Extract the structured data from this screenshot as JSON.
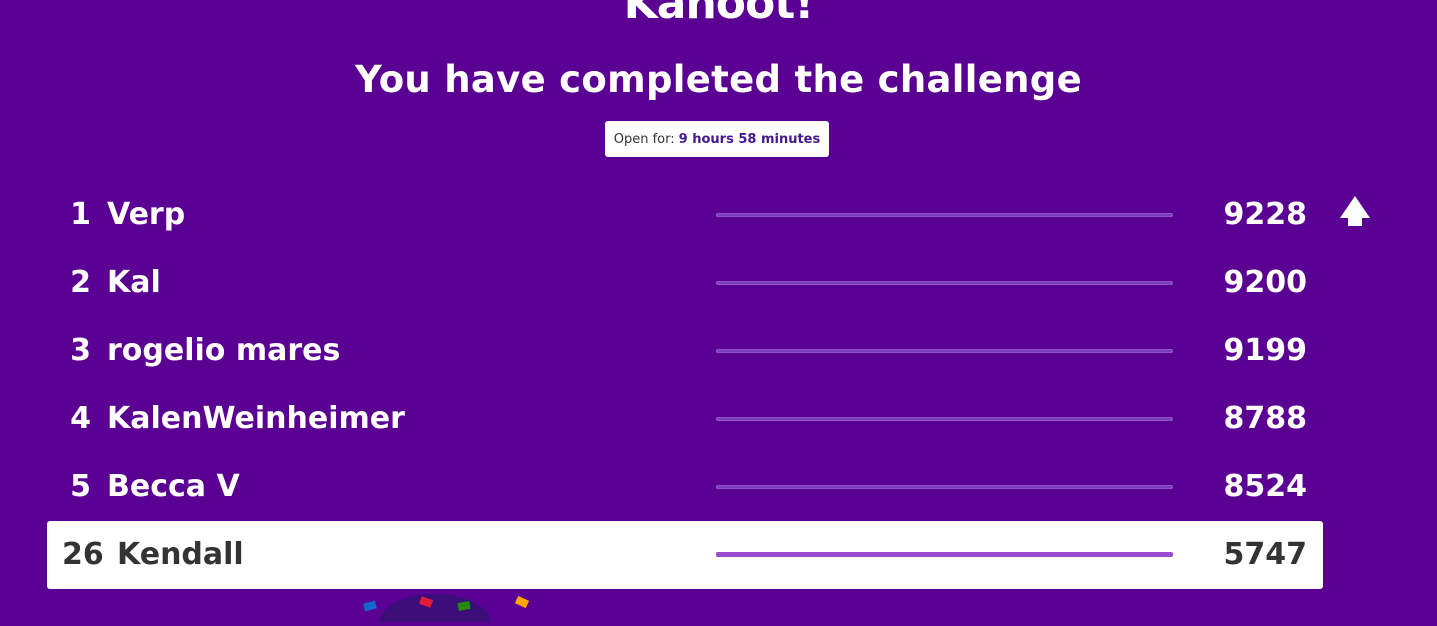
{
  "header": {
    "logo_text": "Kahoot!",
    "title": "You have completed the challenge",
    "open_for_label": "Open for:",
    "open_for_value": "9 hours 58 minutes"
  },
  "leaderboard": [
    {
      "rank": "1",
      "name": "Verp",
      "score": "9228"
    },
    {
      "rank": "2",
      "name": "Kal",
      "score": "9200"
    },
    {
      "rank": "3",
      "name": "rogelio mares",
      "score": "9199"
    },
    {
      "rank": "4",
      "name": "KalenWeinheimer",
      "score": "8788"
    },
    {
      "rank": "5",
      "name": "Becca V",
      "score": "8524"
    }
  ],
  "current_player": {
    "rank": "26",
    "name": "Kendall",
    "score": "5747"
  },
  "icons": {
    "scroll_up": "up-arrow-icon",
    "decoration": "confetti-icon"
  },
  "colors": {
    "background": "#5a0193",
    "highlight_row": "#ffffff",
    "bar": "#7a3fb8",
    "accent": "#46178f"
  }
}
